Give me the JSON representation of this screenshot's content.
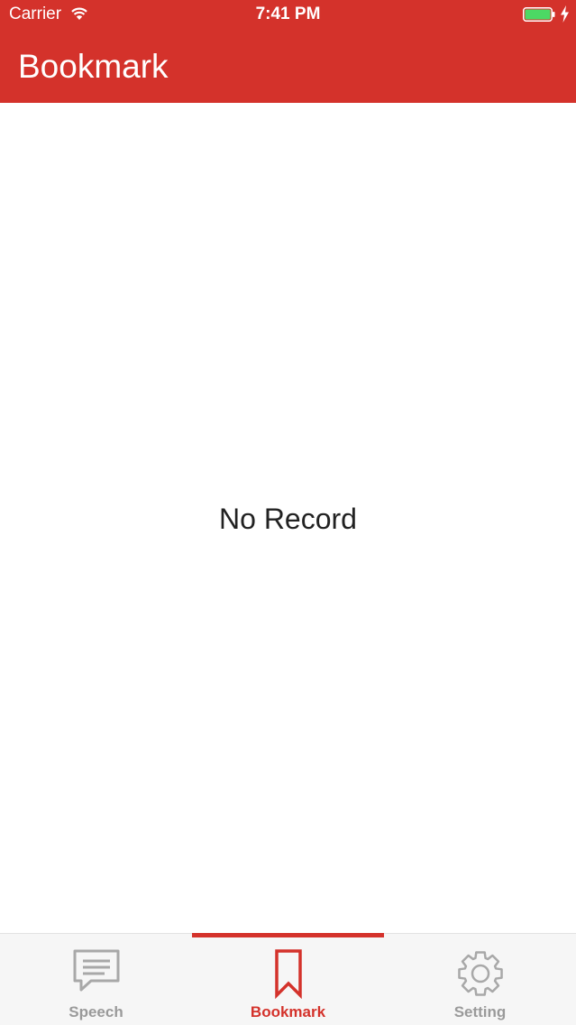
{
  "status_bar": {
    "carrier": "Carrier",
    "time": "7:41 PM",
    "battery_level": 1.0
  },
  "header": {
    "title": "Bookmark"
  },
  "main": {
    "empty_message": "No Record"
  },
  "tabs": [
    {
      "label": "Speech",
      "icon": "speech-bubble-icon",
      "active": false
    },
    {
      "label": "Bookmark",
      "icon": "bookmark-icon",
      "active": true
    },
    {
      "label": "Setting",
      "icon": "gear-icon",
      "active": false
    }
  ],
  "colors": {
    "accent": "#d4322b",
    "inactive": "#9a9a9a",
    "battery": "#4cd964"
  }
}
